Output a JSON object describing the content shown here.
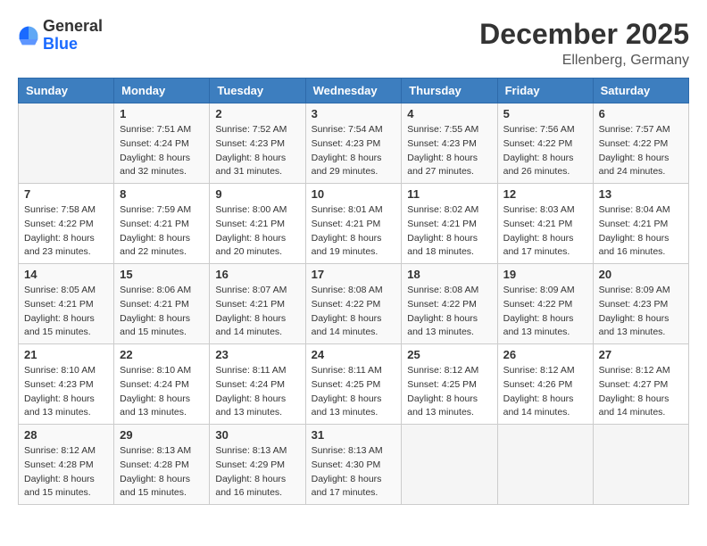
{
  "header": {
    "logo_general": "General",
    "logo_blue": "Blue",
    "month_title": "December 2025",
    "location": "Ellenberg, Germany"
  },
  "days_of_week": [
    "Sunday",
    "Monday",
    "Tuesday",
    "Wednesday",
    "Thursday",
    "Friday",
    "Saturday"
  ],
  "weeks": [
    [
      {
        "day": "",
        "sunrise": "",
        "sunset": "",
        "daylight": ""
      },
      {
        "day": "1",
        "sunrise": "Sunrise: 7:51 AM",
        "sunset": "Sunset: 4:24 PM",
        "daylight": "Daylight: 8 hours and 32 minutes."
      },
      {
        "day": "2",
        "sunrise": "Sunrise: 7:52 AM",
        "sunset": "Sunset: 4:23 PM",
        "daylight": "Daylight: 8 hours and 31 minutes."
      },
      {
        "day": "3",
        "sunrise": "Sunrise: 7:54 AM",
        "sunset": "Sunset: 4:23 PM",
        "daylight": "Daylight: 8 hours and 29 minutes."
      },
      {
        "day": "4",
        "sunrise": "Sunrise: 7:55 AM",
        "sunset": "Sunset: 4:23 PM",
        "daylight": "Daylight: 8 hours and 27 minutes."
      },
      {
        "day": "5",
        "sunrise": "Sunrise: 7:56 AM",
        "sunset": "Sunset: 4:22 PM",
        "daylight": "Daylight: 8 hours and 26 minutes."
      },
      {
        "day": "6",
        "sunrise": "Sunrise: 7:57 AM",
        "sunset": "Sunset: 4:22 PM",
        "daylight": "Daylight: 8 hours and 24 minutes."
      }
    ],
    [
      {
        "day": "7",
        "sunrise": "Sunrise: 7:58 AM",
        "sunset": "Sunset: 4:22 PM",
        "daylight": "Daylight: 8 hours and 23 minutes."
      },
      {
        "day": "8",
        "sunrise": "Sunrise: 7:59 AM",
        "sunset": "Sunset: 4:21 PM",
        "daylight": "Daylight: 8 hours and 22 minutes."
      },
      {
        "day": "9",
        "sunrise": "Sunrise: 8:00 AM",
        "sunset": "Sunset: 4:21 PM",
        "daylight": "Daylight: 8 hours and 20 minutes."
      },
      {
        "day": "10",
        "sunrise": "Sunrise: 8:01 AM",
        "sunset": "Sunset: 4:21 PM",
        "daylight": "Daylight: 8 hours and 19 minutes."
      },
      {
        "day": "11",
        "sunrise": "Sunrise: 8:02 AM",
        "sunset": "Sunset: 4:21 PM",
        "daylight": "Daylight: 8 hours and 18 minutes."
      },
      {
        "day": "12",
        "sunrise": "Sunrise: 8:03 AM",
        "sunset": "Sunset: 4:21 PM",
        "daylight": "Daylight: 8 hours and 17 minutes."
      },
      {
        "day": "13",
        "sunrise": "Sunrise: 8:04 AM",
        "sunset": "Sunset: 4:21 PM",
        "daylight": "Daylight: 8 hours and 16 minutes."
      }
    ],
    [
      {
        "day": "14",
        "sunrise": "Sunrise: 8:05 AM",
        "sunset": "Sunset: 4:21 PM",
        "daylight": "Daylight: 8 hours and 15 minutes."
      },
      {
        "day": "15",
        "sunrise": "Sunrise: 8:06 AM",
        "sunset": "Sunset: 4:21 PM",
        "daylight": "Daylight: 8 hours and 15 minutes."
      },
      {
        "day": "16",
        "sunrise": "Sunrise: 8:07 AM",
        "sunset": "Sunset: 4:21 PM",
        "daylight": "Daylight: 8 hours and 14 minutes."
      },
      {
        "day": "17",
        "sunrise": "Sunrise: 8:08 AM",
        "sunset": "Sunset: 4:22 PM",
        "daylight": "Daylight: 8 hours and 14 minutes."
      },
      {
        "day": "18",
        "sunrise": "Sunrise: 8:08 AM",
        "sunset": "Sunset: 4:22 PM",
        "daylight": "Daylight: 8 hours and 13 minutes."
      },
      {
        "day": "19",
        "sunrise": "Sunrise: 8:09 AM",
        "sunset": "Sunset: 4:22 PM",
        "daylight": "Daylight: 8 hours and 13 minutes."
      },
      {
        "day": "20",
        "sunrise": "Sunrise: 8:09 AM",
        "sunset": "Sunset: 4:23 PM",
        "daylight": "Daylight: 8 hours and 13 minutes."
      }
    ],
    [
      {
        "day": "21",
        "sunrise": "Sunrise: 8:10 AM",
        "sunset": "Sunset: 4:23 PM",
        "daylight": "Daylight: 8 hours and 13 minutes."
      },
      {
        "day": "22",
        "sunrise": "Sunrise: 8:10 AM",
        "sunset": "Sunset: 4:24 PM",
        "daylight": "Daylight: 8 hours and 13 minutes."
      },
      {
        "day": "23",
        "sunrise": "Sunrise: 8:11 AM",
        "sunset": "Sunset: 4:24 PM",
        "daylight": "Daylight: 8 hours and 13 minutes."
      },
      {
        "day": "24",
        "sunrise": "Sunrise: 8:11 AM",
        "sunset": "Sunset: 4:25 PM",
        "daylight": "Daylight: 8 hours and 13 minutes."
      },
      {
        "day": "25",
        "sunrise": "Sunrise: 8:12 AM",
        "sunset": "Sunset: 4:25 PM",
        "daylight": "Daylight: 8 hours and 13 minutes."
      },
      {
        "day": "26",
        "sunrise": "Sunrise: 8:12 AM",
        "sunset": "Sunset: 4:26 PM",
        "daylight": "Daylight: 8 hours and 14 minutes."
      },
      {
        "day": "27",
        "sunrise": "Sunrise: 8:12 AM",
        "sunset": "Sunset: 4:27 PM",
        "daylight": "Daylight: 8 hours and 14 minutes."
      }
    ],
    [
      {
        "day": "28",
        "sunrise": "Sunrise: 8:12 AM",
        "sunset": "Sunset: 4:28 PM",
        "daylight": "Daylight: 8 hours and 15 minutes."
      },
      {
        "day": "29",
        "sunrise": "Sunrise: 8:13 AM",
        "sunset": "Sunset: 4:28 PM",
        "daylight": "Daylight: 8 hours and 15 minutes."
      },
      {
        "day": "30",
        "sunrise": "Sunrise: 8:13 AM",
        "sunset": "Sunset: 4:29 PM",
        "daylight": "Daylight: 8 hours and 16 minutes."
      },
      {
        "day": "31",
        "sunrise": "Sunrise: 8:13 AM",
        "sunset": "Sunset: 4:30 PM",
        "daylight": "Daylight: 8 hours and 17 minutes."
      },
      {
        "day": "",
        "sunrise": "",
        "sunset": "",
        "daylight": ""
      },
      {
        "day": "",
        "sunrise": "",
        "sunset": "",
        "daylight": ""
      },
      {
        "day": "",
        "sunrise": "",
        "sunset": "",
        "daylight": ""
      }
    ]
  ]
}
